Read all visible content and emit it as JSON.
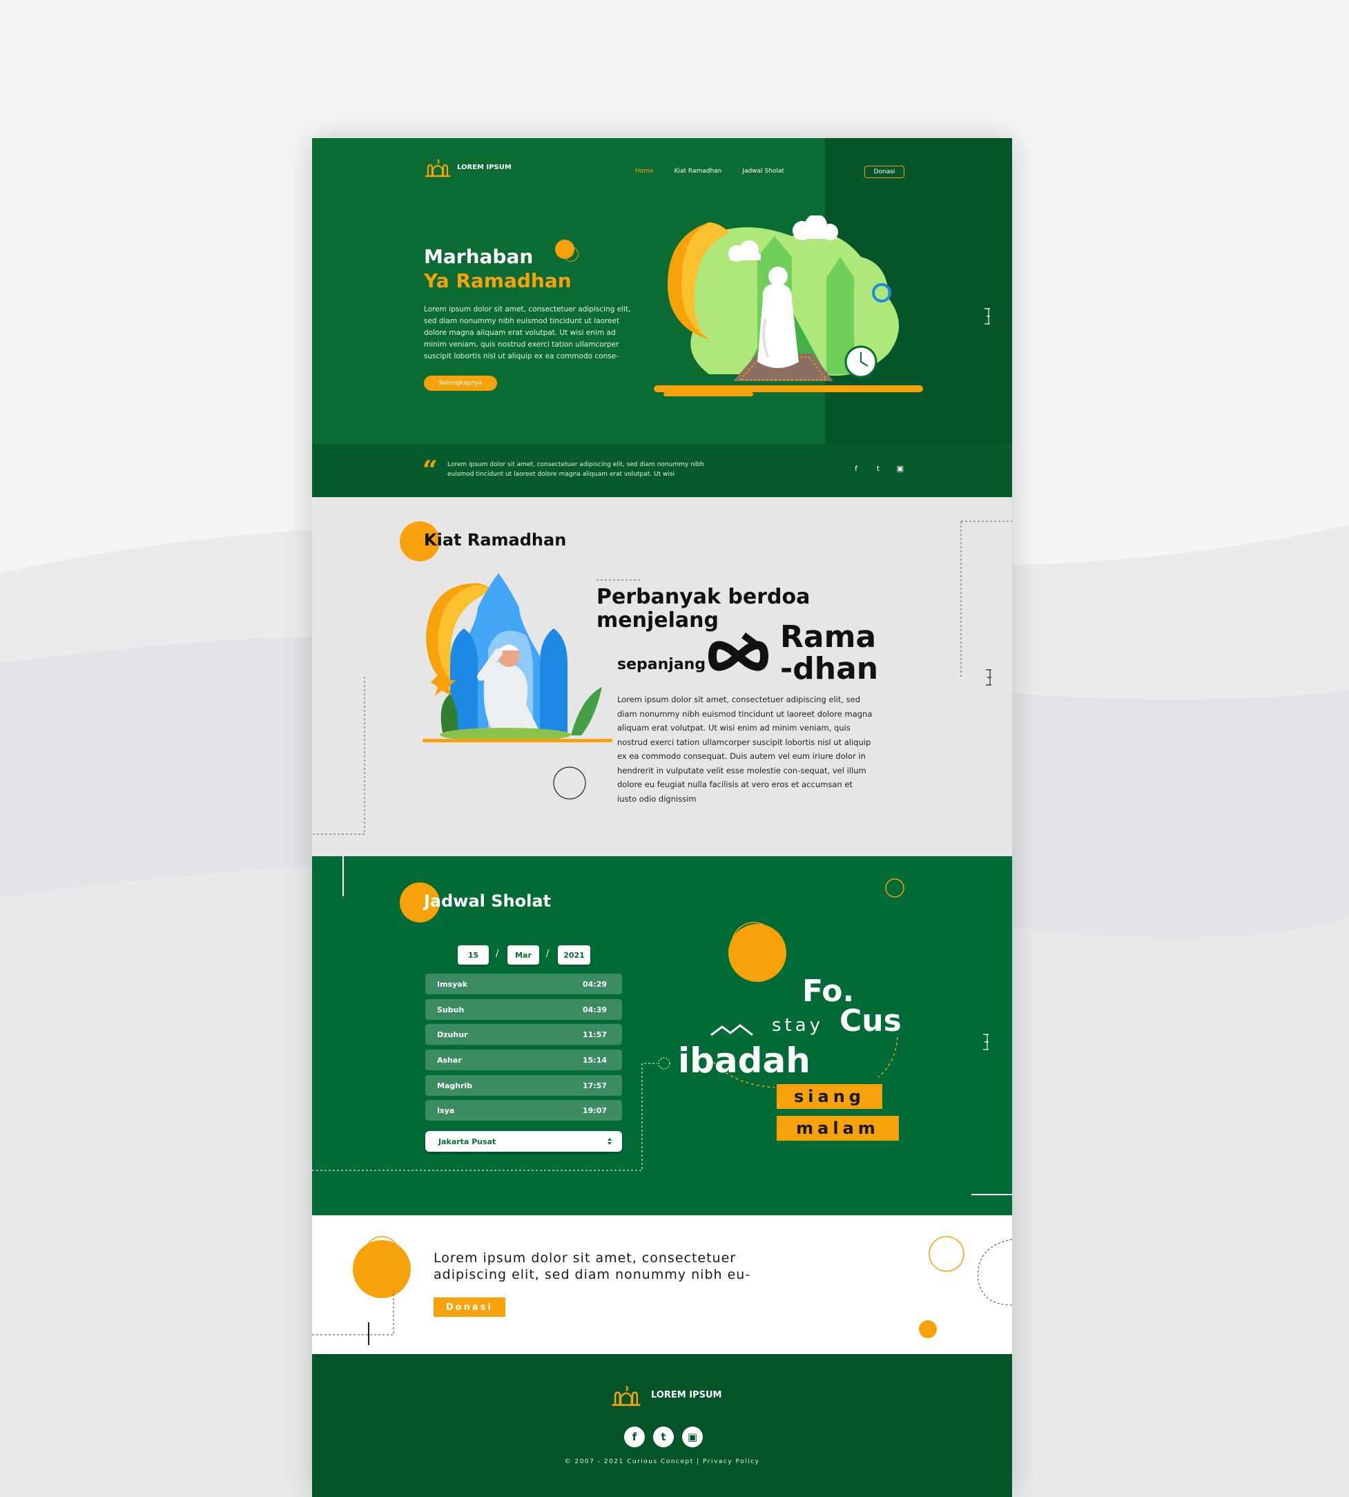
{
  "brand": {
    "name": "LOREM IPSUM"
  },
  "nav": {
    "home": "Home",
    "kiat": "Kiat Ramadhan",
    "jadwal": "Jadwal Sholat",
    "donasi": "Donasi"
  },
  "hero": {
    "title1": "Marhaban",
    "title2": "Ya Ramadhan",
    "body": "Lorem ipsum dolor sit amet, consectetuer adipiscing elit, sed diam nonummy nibh euismod tincidunt ut laoreet dolore magna aliquam erat volutpat. Ut wisi enim ad minim veniam, quis nostrud exerci tation ullamcorper suscipit lobortis nisl ut aliquip ex ea commodo conse-",
    "button": "Selengkapnya",
    "quote_mark": "“",
    "quote": "Lorem ipsum dolor sit amet, consectetuer adipiscing elit, sed diam nonummy nibh euismod tincidunt ut laoreet dolore magna aliquam erat volutpat. Ut wisi"
  },
  "social": {
    "facebook": "f",
    "twitter": "t",
    "instagram": "▣"
  },
  "kiat": {
    "title": "Kiat Ramadhan",
    "headline1": "Perbanyak berdoa",
    "headline2": "menjelang",
    "sepanjang": "sepanjang",
    "rama1": "Rama",
    "rama2": "-dhan",
    "body": "Lorem ipsum dolor sit amet, consectetuer adipiscing elit, sed diam nonummy nibh euismod tincidunt ut laoreet dolore magna aliquam erat volutpat. Ut wisi enim ad minim veniam, quis nostrud exerci tation ullamcorper suscipit lobortis nisl ut aliquip ex ea commodo consequat. Duis autem vel eum iriure dolor in hendrerit in vulputate velit esse molestie con-sequat, vel illum dolore eu feugiat nulla facilisis at vero eros et accumsan et iusto odio dignissim"
  },
  "jadwal": {
    "title": "Jadwal Sholat",
    "date": {
      "day": "15",
      "month": "Mar",
      "year": "2021",
      "sep": "/"
    },
    "prayers": [
      {
        "name": "Imsyak",
        "time": "04:29"
      },
      {
        "name": "Subuh",
        "time": "04:39"
      },
      {
        "name": "Dzuhur",
        "time": "11:57"
      },
      {
        "name": "Ashar",
        "time": "15:14"
      },
      {
        "name": "Maghrib",
        "time": "17:57"
      },
      {
        "name": "Isya",
        "time": "19:07"
      }
    ],
    "city": "Jakarta Pusat",
    "focus": {
      "fo": "Fo.",
      "cus": "Cus",
      "stay": "stay",
      "ibadah": "ibadah",
      "siang": "siang",
      "malam": "malam"
    }
  },
  "donasi": {
    "text": "Lorem ipsum dolor sit amet, consectetuer adipiscing elit, sed diam nonummy nibh eu-",
    "button": "Donasi"
  },
  "footer": {
    "copyright": "© 2007 - 2021 Curious Concept | Privacy Policy"
  },
  "colors": {
    "green": "#0a6b33",
    "dark_green": "#04552a",
    "orange": "#f7a20a",
    "grey": "#e6e6e6"
  }
}
